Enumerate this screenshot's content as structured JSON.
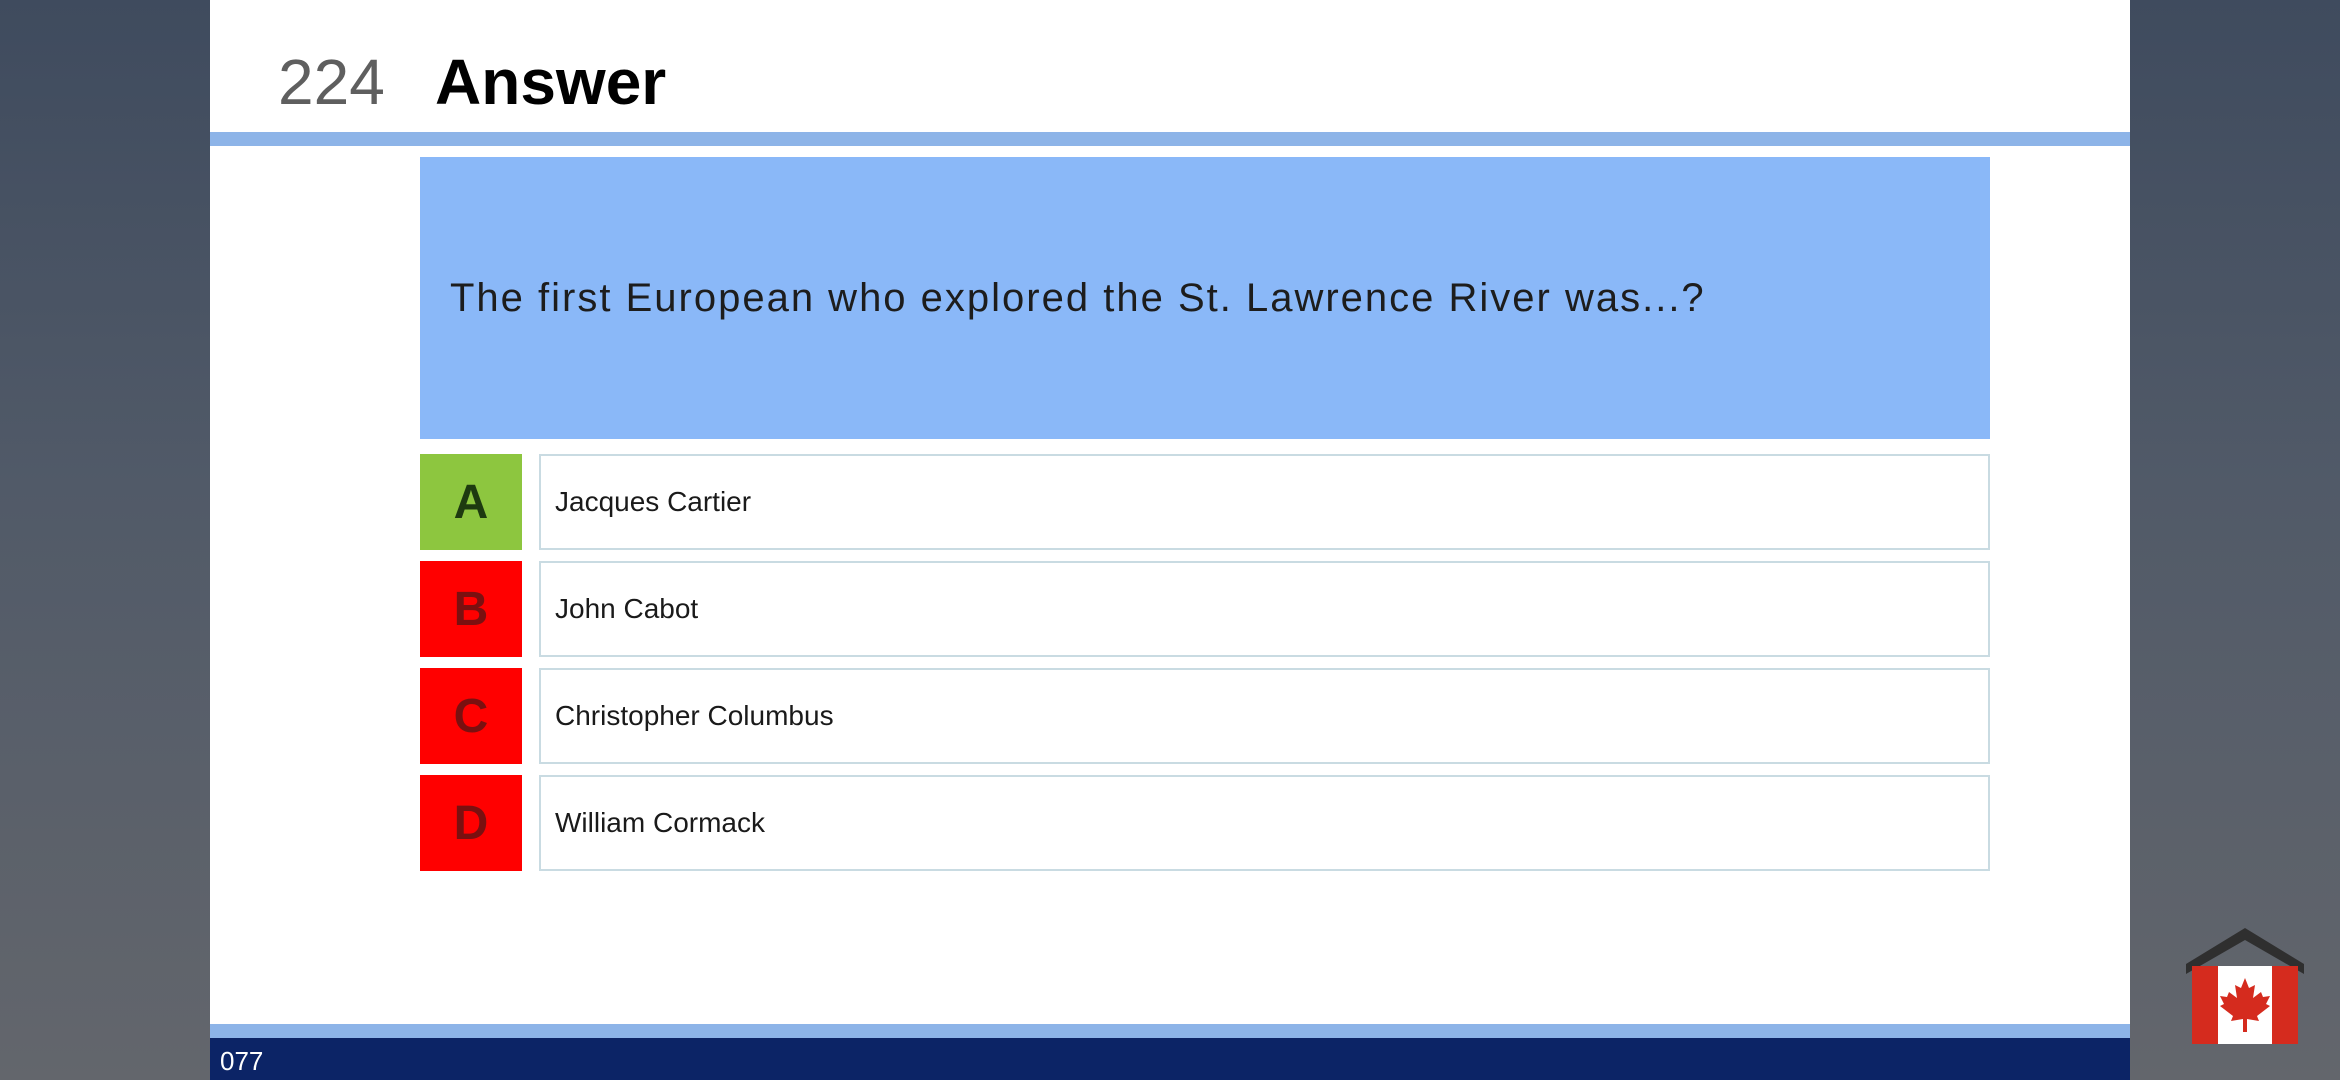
{
  "slide": {
    "number": "224",
    "title": "Answer",
    "footer_code": "077"
  },
  "question": {
    "text": "The first European who explored the St. Lawrence River was...?"
  },
  "options": [
    {
      "letter": "A",
      "text": "Jacques Cartier",
      "color": "#8dc63f",
      "letter_color": "#1e3a10",
      "status": "correct"
    },
    {
      "letter": "B",
      "text": "John Cabot",
      "color": "#ff0000",
      "letter_color": "#7a1010",
      "status": "incorrect"
    },
    {
      "letter": "C",
      "text": "Christopher Columbus",
      "color": "#ff0000",
      "letter_color": "#7a1010",
      "status": "incorrect"
    },
    {
      "letter": "D",
      "text": "William Cormack",
      "color": "#ff0000",
      "letter_color": "#7a1010",
      "status": "incorrect"
    }
  ],
  "colors": {
    "accent": "#8db4e8",
    "question_bg": "#8ab8f8",
    "footer_bg": "#0c2466",
    "correct": "#8dc63f",
    "incorrect": "#ff0000"
  },
  "logo": {
    "icon": "canada-flag-house-icon"
  }
}
